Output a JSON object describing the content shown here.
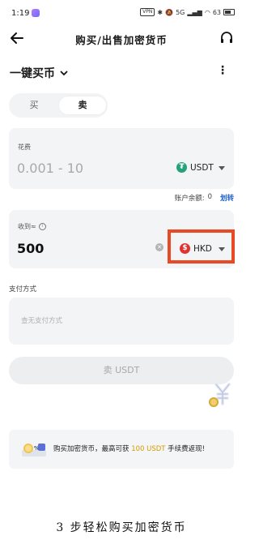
{
  "status_bar": {
    "time": "1:19",
    "vpn": "VPN",
    "signal": "5G",
    "battery": "63"
  },
  "header": {
    "title": "购买/出售加密货币"
  },
  "mode": {
    "label": "一键买币",
    "more": "⋮"
  },
  "tabs": [
    {
      "label": "买",
      "selected": false
    },
    {
      "label": "卖",
      "selected": true
    }
  ],
  "spend": {
    "label": "花费",
    "placeholder": "0.001 - 10",
    "currency": "USDT",
    "currency_icon_color": "#26a17b"
  },
  "balance": {
    "label": "账户余额:",
    "value": "0",
    "transfer": "划转"
  },
  "receive": {
    "label": "收到≈",
    "value": "500",
    "currency": "HKD",
    "currency_icon_color": "#e0332f"
  },
  "payment": {
    "label": "支付方式",
    "placeholder": "查无支付方式"
  },
  "sell_button": {
    "label": "卖 USDT"
  },
  "promo": {
    "text_before": "购买加密货币，最高可获 ",
    "highlight": "100 USDT",
    "text_after": " 手续费返现!"
  },
  "caption": "3 步轻松购买加密货币",
  "colors": {
    "accent_gold": "#d39a00",
    "link_blue": "#1a5fc8",
    "highlight_red": "#e84a25"
  }
}
